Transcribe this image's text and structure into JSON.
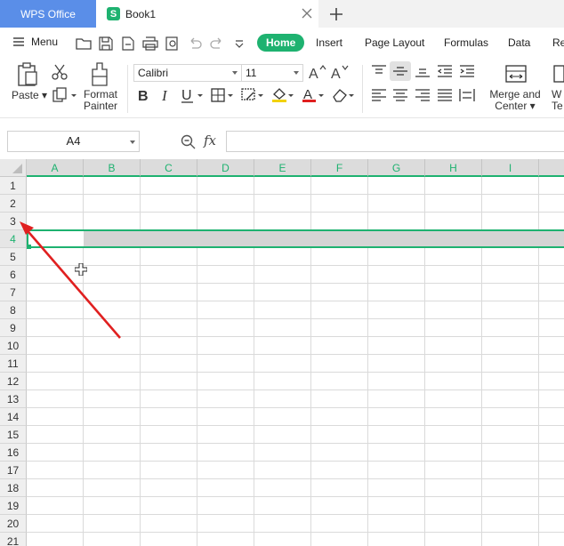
{
  "tabs": {
    "app_label": "WPS Office",
    "doc_icon_letter": "S",
    "doc_label": "Book1"
  },
  "menu": {
    "menu_label": "Menu",
    "ribbon_tabs": [
      "Home",
      "Insert",
      "Page Layout",
      "Formulas",
      "Data",
      "Re"
    ]
  },
  "ribbon": {
    "paste_label": "Paste",
    "format_painter_line1": "Format",
    "format_painter_line2": "Painter",
    "font_name": "Calibri",
    "font_size": "11",
    "merge_line1": "Merge and",
    "merge_line2": "Center",
    "wrap_line1": "W",
    "wrap_line2": "Te"
  },
  "formula_bar": {
    "name_box_value": "A4",
    "fx_label": "fx",
    "formula_value": ""
  },
  "grid": {
    "columns": [
      "A",
      "B",
      "C",
      "D",
      "E",
      "F",
      "G",
      "H",
      "I"
    ],
    "rows": [
      "1",
      "2",
      "3",
      "4",
      "5",
      "6",
      "7",
      "8",
      "9",
      "10",
      "11",
      "12",
      "13",
      "14",
      "15",
      "16",
      "17",
      "18",
      "19",
      "20",
      "21"
    ],
    "selected_row": "4",
    "selected_cell": "A4"
  },
  "colors": {
    "accent": "#1eb270",
    "tab_blue": "#5a8ee8",
    "annotation_arrow": "#e02020"
  }
}
